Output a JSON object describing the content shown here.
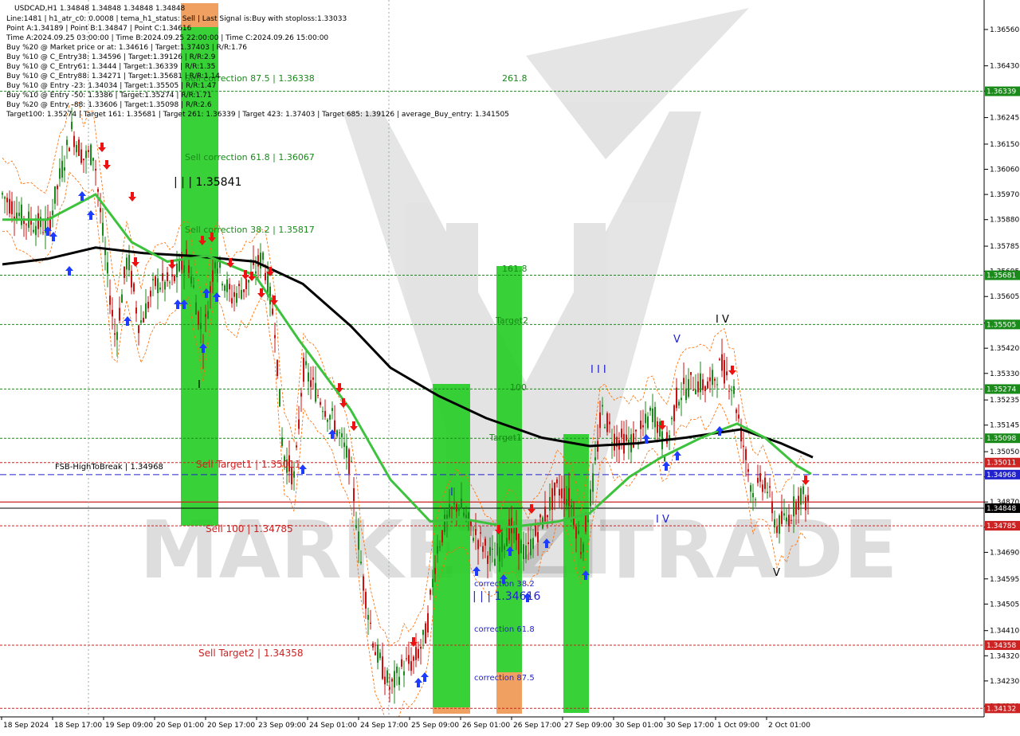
{
  "header": {
    "symbol_line": "USDCAD,H1  1.34848 1.34848 1.34848 1.34848",
    "lines": [
      "Line:1481  |  h1_atr_c0: 0.0008  |  tema_h1_status: Sell  |  Last Signal is:Buy with stoploss:1.33033",
      "Point A:1.34189  |  Point B:1.34847  |  Point C:1.34616",
      "Time A:2024.09.25 03:00:00  |  Time B:2024.09.25 22:00:00  |  Time C:2024.09.26 15:00:00",
      "Buy %20 @ Market price or at: 1.34616  |  Target:1.37403  |  R/R:1.76",
      "Buy %10 @ C_Entry38: 1.34596  |  Target:1.39126  |  R/R:2.9",
      "Buy %10 @ C_Entry61: 1.3444  |  Target:1.36339  |  R/R:1.35",
      "Buy %10 @ C_Entry88: 1.34271  |  Target:1.35681  |  R/R:1.14",
      "Buy %10 @ Entry -23: 1.34034  |  Target:1.35505  |  R/R:1.47",
      "Buy %10 @ Entry -50: 1.3386  |  Target:1.35274  |  R/R:1.71",
      "Buy %20 @ Entry -88: 1.33606  |  Target:1.35098  |  R/R:2.6",
      "Target100: 1.35274  |  Target 161: 1.35681  |  Target 261: 1.36339  |  Target 423: 1.37403  |  Target 685: 1.39126  |  average_Buy_entry: 1.341505"
    ]
  },
  "chart_data": {
    "type": "candlestick",
    "symbol": "USDCAD",
    "timeframe": "H1",
    "ylim": [
      1.3411,
      1.3658
    ],
    "price_ticks": [
      "1.36560",
      "1.36430",
      "1.36340",
      "1.36245",
      "1.36150",
      "1.36060",
      "1.35970",
      "1.35880",
      "1.35785",
      "1.35695",
      "1.35605",
      "1.35510",
      "1.35420",
      "1.35330",
      "1.35235",
      "1.35145",
      "1.35050",
      "1.34960",
      "1.34870",
      "1.34780",
      "1.34690",
      "1.34595",
      "1.34505",
      "1.34410",
      "1.34320",
      "1.34230",
      "1.34140"
    ],
    "time_labels": [
      "18 Sep 2024",
      "18 Sep 17:00",
      "19 Sep 09:00",
      "20 Sep 01:00",
      "20 Sep 17:00",
      "23 Sep 09:00",
      "24 Sep 01:00",
      "24 Sep 17:00",
      "25 Sep 09:00",
      "26 Sep 01:00",
      "26 Sep 17:00",
      "27 Sep 09:00",
      "30 Sep 01:00",
      "30 Sep 17:00",
      "1 Oct 09:00",
      "2 Oct 01:00"
    ],
    "horizontal_levels": [
      {
        "price": 1.36339,
        "label": "1.36339",
        "color": "#1a8a1a",
        "style": "dotted"
      },
      {
        "price": 1.35681,
        "label": "1.35681",
        "color": "#1a8a1a",
        "style": "dotted"
      },
      {
        "price": 1.35505,
        "label": "1.35505",
        "color": "#1a8a1a",
        "style": "dotted"
      },
      {
        "price": 1.35274,
        "label": "1.35274",
        "color": "#1a8a1a",
        "style": "dotted"
      },
      {
        "price": 1.35098,
        "label": "1.35098",
        "color": "#1a8a1a",
        "style": "dotted"
      },
      {
        "price": 1.35011,
        "label": "1.35011",
        "color": "#cc2222",
        "style": "dotted"
      },
      {
        "price": 1.34968,
        "label": "1.34968",
        "color": "#2222cc",
        "style": "dashed"
      },
      {
        "price": 1.34848,
        "label": "1.34848",
        "color": "#000000",
        "style": "solid"
      },
      {
        "price": 1.34785,
        "label": "1.34785",
        "color": "#cc2222",
        "style": "dotted"
      },
      {
        "price": 1.34358,
        "label": "1.34358",
        "color": "#cc2222",
        "style": "dotted"
      },
      {
        "price": 1.34132,
        "label": "1.34132",
        "color": "#cc2222",
        "style": "dotted"
      }
    ],
    "zone_labels": [
      {
        "text": "Sell correction 87.5 | 1.36338",
        "price": 1.36338,
        "color": "#1a8a1a"
      },
      {
        "text": "261.8",
        "price": 1.36339,
        "color": "#1a8a1a"
      },
      {
        "text": "Sell correction 61.8 | 1.36067",
        "price": 1.36067,
        "color": "#1a8a1a"
      },
      {
        "text": "| | | 1.35841",
        "price": 1.35841,
        "color": "#000000"
      },
      {
        "text": "Sell correction 38.2 | 1.35817",
        "price": 1.35817,
        "color": "#1a8a1a"
      },
      {
        "text": "161.8",
        "price": 1.35681,
        "color": "#1a8a1a"
      },
      {
        "text": "Target2",
        "price": 1.35505,
        "color": "#1a8a1a"
      },
      {
        "text": "100",
        "price": 1.35274,
        "color": "#1a8a1a"
      },
      {
        "text": "Target1",
        "price": 1.35098,
        "color": "#1a8a1a"
      },
      {
        "text": "FSB-HighToBreak | 1.34968",
        "price": 1.34968,
        "color": "#000000"
      },
      {
        "text": "Sell Target1 | 1.35011",
        "price": 1.35011,
        "color": "#cc2222"
      },
      {
        "text": "Sell 100 | 1.34785",
        "price": 1.34785,
        "color": "#cc2222"
      },
      {
        "text": "correction 38.2",
        "price": 1.34596,
        "color": "#2222cc"
      },
      {
        "text": "| | | 1.34616",
        "price": 1.34616,
        "color": "#2222cc"
      },
      {
        "text": "correction 61.8",
        "price": 1.3444,
        "color": "#2222cc"
      },
      {
        "text": "correction 87.5",
        "price": 1.34271,
        "color": "#2222cc"
      },
      {
        "text": "Sell Target2 | 1.34358",
        "price": 1.34358,
        "color": "#cc2222"
      }
    ],
    "wave_labels": [
      "I",
      "I",
      "I",
      "I I I",
      "V",
      "I V",
      "I V",
      "V"
    ],
    "watermark": "MARKETZITRADE"
  },
  "colors": {
    "bull_candle": "#1a8a1a",
    "bear_candle": "#cc1111",
    "ma_fast": "#3cc23c",
    "ma_slow": "#000000",
    "envelope": "#ff6a00",
    "zone_green": "#22cc22",
    "zone_orange": "#f0a060",
    "buy_arrow": "#1e3cff",
    "sell_arrow": "#ee1111"
  }
}
